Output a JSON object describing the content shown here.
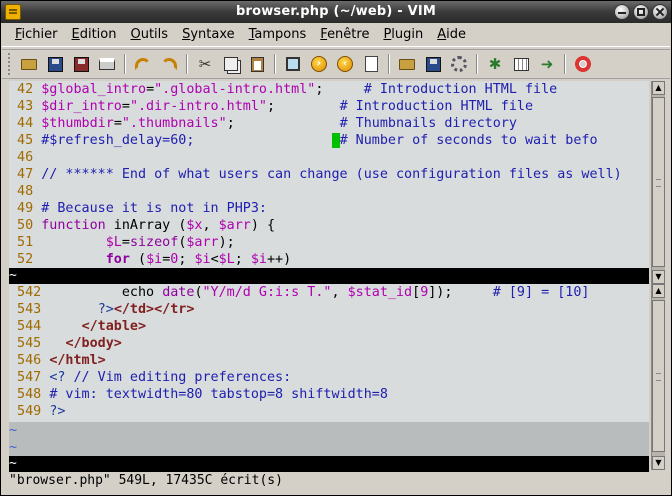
{
  "window": {
    "title": "browser.php (~/web) - VIM"
  },
  "menu": [
    "Fichier",
    "Edition",
    "Outils",
    "Syntaxe",
    "Tampons",
    "Fenêtre",
    "Plugin",
    "Aide"
  ],
  "toolbar_icons": [
    "open-icon",
    "save-icon",
    "save-all-icon",
    "print-icon",
    "undo-icon",
    "redo-icon",
    "cut-icon",
    "copy-icon",
    "paste-icon",
    "find-replace-icon",
    "find-next-icon",
    "find-prev-icon",
    "load-session-icon",
    "save-session-icon",
    "run-script-icon",
    "make-icon",
    "shell-icon",
    "run-ctags-icon",
    "tag-jump-icon",
    "help-icon"
  ],
  "top_pane": {
    "lines": [
      {
        "n": "42",
        "code": [
          [
            "v",
            "$global_intro"
          ],
          [
            "p",
            "="
          ],
          [
            "s",
            "\".global-intro.html\""
          ],
          [
            "p",
            ";"
          ],
          [
            "sp",
            "     "
          ],
          [
            "c",
            "# Introduction HTML file"
          ]
        ]
      },
      {
        "n": "43",
        "code": [
          [
            "v",
            "$dir_intro"
          ],
          [
            "p",
            "="
          ],
          [
            "s",
            "\".dir-intro.html\""
          ],
          [
            "p",
            ";"
          ],
          [
            "sp",
            "        "
          ],
          [
            "c",
            "# Introduction HTML file"
          ]
        ]
      },
      {
        "n": "44",
        "code": [
          [
            "v",
            "$thumbdir"
          ],
          [
            "p",
            "="
          ],
          [
            "s",
            "\".thumbnails\""
          ],
          [
            "p",
            ";"
          ],
          [
            "sp",
            "             "
          ],
          [
            "c",
            "# Thumbnails directory"
          ]
        ]
      },
      {
        "n": "45",
        "code": [
          [
            "c",
            "#$refresh_delay=60;"
          ],
          [
            "sp",
            "                 "
          ],
          [
            "cur",
            " "
          ],
          [
            "c",
            "# Number of seconds to wait befo"
          ]
        ]
      },
      {
        "n": "46",
        "code": []
      },
      {
        "n": "47",
        "code": [
          [
            "c",
            "// ****** End of what users can change (use configuration files as well)"
          ]
        ]
      },
      {
        "n": "48",
        "code": []
      },
      {
        "n": "49",
        "code": [
          [
            "c",
            "# Because it is not in PHP3:"
          ]
        ]
      },
      {
        "n": "50",
        "code": [
          [
            "k",
            "function"
          ],
          [
            "d",
            " inArray "
          ],
          [
            "p",
            "("
          ],
          [
            "v",
            "$x"
          ],
          [
            "p",
            ", "
          ],
          [
            "v",
            "$arr"
          ],
          [
            "p",
            ") {"
          ]
        ]
      },
      {
        "n": "51",
        "code": [
          [
            "d",
            "        "
          ],
          [
            "v",
            "$L"
          ],
          [
            "p",
            "="
          ],
          [
            "k",
            "sizeof"
          ],
          [
            "p",
            "("
          ],
          [
            "v",
            "$arr"
          ],
          [
            "p",
            ");"
          ]
        ]
      },
      {
        "n": "52",
        "code": [
          [
            "d",
            "        "
          ],
          [
            "kb",
            "for"
          ],
          [
            "p",
            " ("
          ],
          [
            "v",
            "$i"
          ],
          [
            "p",
            "="
          ],
          [
            "s",
            "0"
          ],
          [
            "p",
            "; "
          ],
          [
            "v",
            "$i"
          ],
          [
            "p",
            "<"
          ],
          [
            "v",
            "$L"
          ],
          [
            "p",
            "; "
          ],
          [
            "v",
            "$i"
          ],
          [
            "p",
            "++)"
          ]
        ]
      }
    ],
    "status": "~"
  },
  "bottom_pane": {
    "lines": [
      {
        "n": "542",
        "code": [
          [
            "d",
            "         echo "
          ],
          [
            "k",
            "date"
          ],
          [
            "p",
            "("
          ],
          [
            "s",
            "\"Y/m/d G:i:s T.\""
          ],
          [
            "p",
            ", "
          ],
          [
            "v",
            "$stat_id"
          ],
          [
            "p",
            "["
          ],
          [
            "s",
            "9"
          ],
          [
            "p",
            "]);"
          ],
          [
            "sp",
            "     "
          ],
          [
            "c",
            "# [9] = [10]"
          ]
        ]
      },
      {
        "n": "543",
        "code": [
          [
            "d",
            "      "
          ],
          [
            "ph",
            "?>"
          ],
          [
            "tag",
            "</td></tr>"
          ]
        ]
      },
      {
        "n": "544",
        "code": [
          [
            "d",
            "    "
          ],
          [
            "tag",
            "</table>"
          ]
        ]
      },
      {
        "n": "545",
        "code": [
          [
            "d",
            "  "
          ],
          [
            "tag",
            "</body>"
          ]
        ]
      },
      {
        "n": "546",
        "code": [
          [
            "tag",
            "</html>"
          ]
        ]
      },
      {
        "n": "547",
        "code": [
          [
            "ph",
            "<?"
          ],
          [
            "c",
            " // Vim editing preferences:"
          ]
        ]
      },
      {
        "n": "548",
        "code": [
          [
            "c",
            "# vim: textwidth=80 tabstop=8 shiftwidth=8"
          ]
        ]
      },
      {
        "n": "549",
        "code": [
          [
            "ph",
            "?>"
          ]
        ]
      }
    ],
    "tildes": [
      "~",
      "~"
    ],
    "status": "~"
  },
  "cmdline": "\"browser.php\" 549L, 17435C écrit(s)",
  "colors": {
    "background": "#d8dcdc",
    "string": "#b000b0",
    "comment": "#2020b0",
    "line_number": "#a06a00",
    "cursor": "#00c000"
  }
}
